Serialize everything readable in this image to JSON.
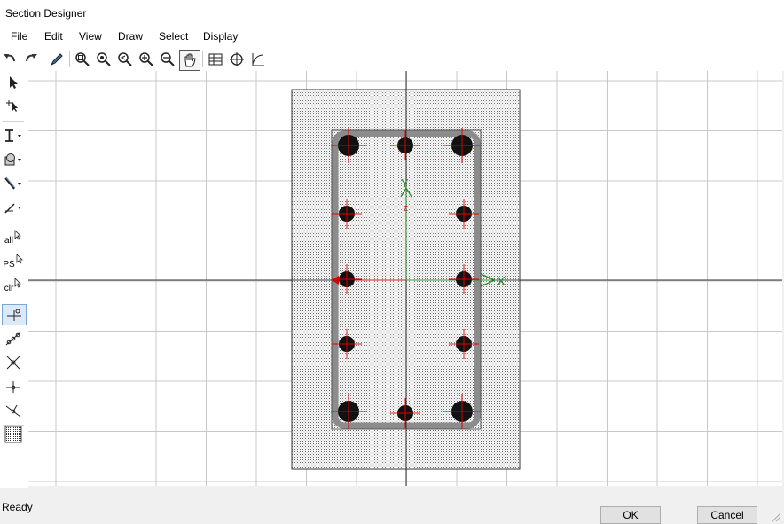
{
  "window": {
    "title": "Section Designer"
  },
  "menu": {
    "items": [
      "File",
      "Edit",
      "View",
      "Draw",
      "Select",
      "Display"
    ]
  },
  "left_tools": {
    "all_label": "all",
    "ps_label": "PS",
    "clr_label": "clr"
  },
  "canvas": {
    "x_axis_label": "X",
    "y_axis_label": "Y",
    "z_axis_label": "Z"
  },
  "status": {
    "text": "Ready"
  },
  "buttons": {
    "ok": "OK",
    "cancel": "Cancel"
  },
  "colors": {
    "rebar": "#111111",
    "crosshair": "#e00000",
    "stirrup": "#888888",
    "axis_x": "#2a8a2a"
  }
}
